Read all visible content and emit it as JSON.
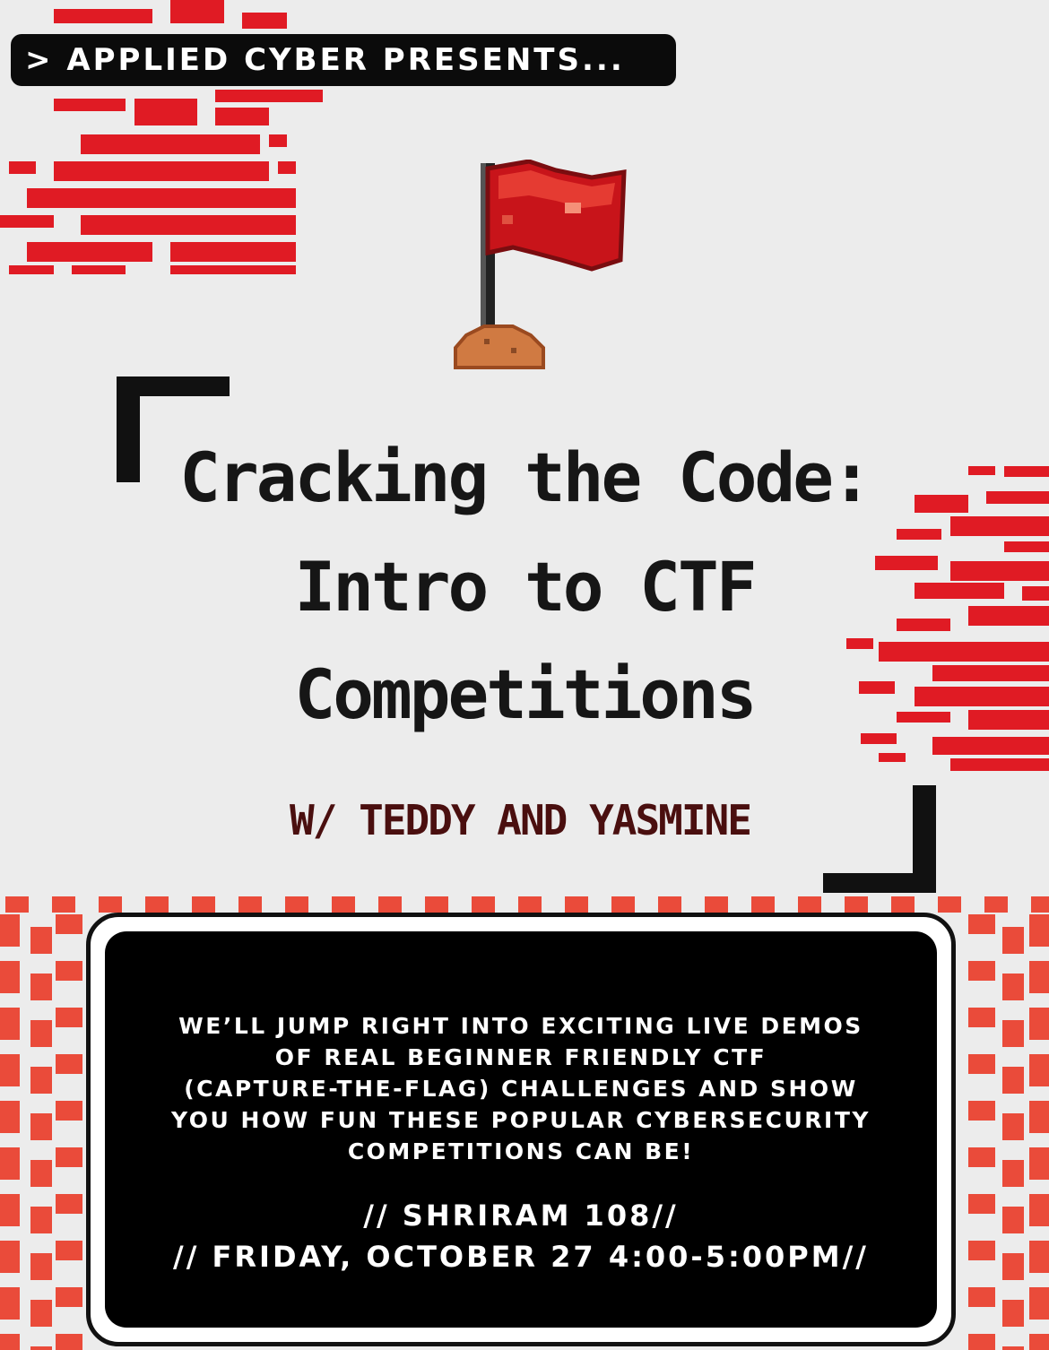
{
  "header": {
    "presents": "> APPLIED CYBER PRESENTS..."
  },
  "title": {
    "lines": [
      "Cracking the Code:",
      "Intro to CTF",
      "Competitions"
    ]
  },
  "subtitle": "W/ TEDDY AND YASMINE",
  "info": {
    "description": "WE’LL JUMP RIGHT INTO EXCITING LIVE DEMOS\nOF REAL BEGINNER FRIENDLY CTF\n(CAPTURE-THE-FLAG) CHALLENGES AND SHOW\nYOU HOW FUN THESE POPULAR CYBERSECURITY\nCOMPETITIONS CAN BE!",
    "location": "// SHRIRAM 108//",
    "datetime": "// FRIDAY, OCTOBER 27 4:00-5:00PM//"
  },
  "colors": {
    "background": "#ececec",
    "glitch_red": "#e01b24",
    "pattern_red": "#ea4b3a",
    "info_box": "#000000",
    "title_text": "#161616",
    "subtitle_text": "#4a0f0f"
  },
  "icons": [
    "flag-icon"
  ]
}
